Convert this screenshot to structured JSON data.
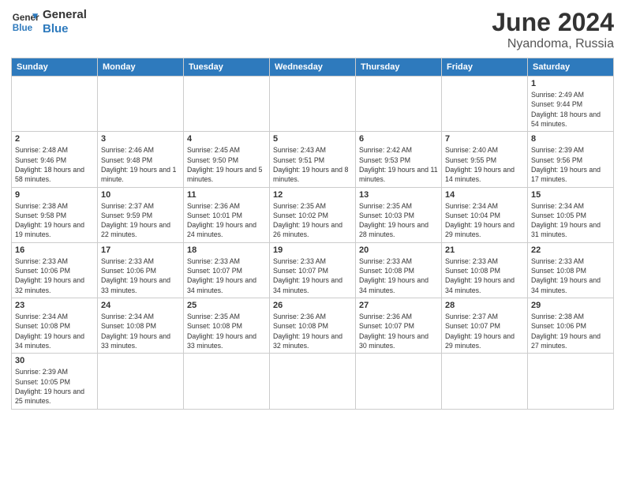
{
  "header": {
    "logo_general": "General",
    "logo_blue": "Blue",
    "title": "June 2024",
    "location": "Nyandoma, Russia"
  },
  "weekdays": [
    "Sunday",
    "Monday",
    "Tuesday",
    "Wednesday",
    "Thursday",
    "Friday",
    "Saturday"
  ],
  "days": {
    "d1": {
      "num": "1",
      "sunrise": "2:49 AM",
      "sunset": "9:44 PM",
      "daylight": "18 hours and 54 minutes."
    },
    "d2": {
      "num": "2",
      "sunrise": "2:48 AM",
      "sunset": "9:46 PM",
      "daylight": "18 hours and 58 minutes."
    },
    "d3": {
      "num": "3",
      "sunrise": "2:46 AM",
      "sunset": "9:48 PM",
      "daylight": "19 hours and 1 minute."
    },
    "d4": {
      "num": "4",
      "sunrise": "2:45 AM",
      "sunset": "9:50 PM",
      "daylight": "19 hours and 5 minutes."
    },
    "d5": {
      "num": "5",
      "sunrise": "2:43 AM",
      "sunset": "9:51 PM",
      "daylight": "19 hours and 8 minutes."
    },
    "d6": {
      "num": "6",
      "sunrise": "2:42 AM",
      "sunset": "9:53 PM",
      "daylight": "19 hours and 11 minutes."
    },
    "d7": {
      "num": "7",
      "sunrise": "2:40 AM",
      "sunset": "9:55 PM",
      "daylight": "19 hours and 14 minutes."
    },
    "d8": {
      "num": "8",
      "sunrise": "2:39 AM",
      "sunset": "9:56 PM",
      "daylight": "19 hours and 17 minutes."
    },
    "d9": {
      "num": "9",
      "sunrise": "2:38 AM",
      "sunset": "9:58 PM",
      "daylight": "19 hours and 19 minutes."
    },
    "d10": {
      "num": "10",
      "sunrise": "2:37 AM",
      "sunset": "9:59 PM",
      "daylight": "19 hours and 22 minutes."
    },
    "d11": {
      "num": "11",
      "sunrise": "2:36 AM",
      "sunset": "10:01 PM",
      "daylight": "19 hours and 24 minutes."
    },
    "d12": {
      "num": "12",
      "sunrise": "2:35 AM",
      "sunset": "10:02 PM",
      "daylight": "19 hours and 26 minutes."
    },
    "d13": {
      "num": "13",
      "sunrise": "2:35 AM",
      "sunset": "10:03 PM",
      "daylight": "19 hours and 28 minutes."
    },
    "d14": {
      "num": "14",
      "sunrise": "2:34 AM",
      "sunset": "10:04 PM",
      "daylight": "19 hours and 29 minutes."
    },
    "d15": {
      "num": "15",
      "sunrise": "2:34 AM",
      "sunset": "10:05 PM",
      "daylight": "19 hours and 31 minutes."
    },
    "d16": {
      "num": "16",
      "sunrise": "2:33 AM",
      "sunset": "10:06 PM",
      "daylight": "19 hours and 32 minutes."
    },
    "d17": {
      "num": "17",
      "sunrise": "2:33 AM",
      "sunset": "10:06 PM",
      "daylight": "19 hours and 33 minutes."
    },
    "d18": {
      "num": "18",
      "sunrise": "2:33 AM",
      "sunset": "10:07 PM",
      "daylight": "19 hours and 34 minutes."
    },
    "d19": {
      "num": "19",
      "sunrise": "2:33 AM",
      "sunset": "10:07 PM",
      "daylight": "19 hours and 34 minutes."
    },
    "d20": {
      "num": "20",
      "sunrise": "2:33 AM",
      "sunset": "10:08 PM",
      "daylight": "19 hours and 34 minutes."
    },
    "d21": {
      "num": "21",
      "sunrise": "2:33 AM",
      "sunset": "10:08 PM",
      "daylight": "19 hours and 34 minutes."
    },
    "d22": {
      "num": "22",
      "sunrise": "2:33 AM",
      "sunset": "10:08 PM",
      "daylight": "19 hours and 34 minutes."
    },
    "d23": {
      "num": "23",
      "sunrise": "2:34 AM",
      "sunset": "10:08 PM",
      "daylight": "19 hours and 34 minutes."
    },
    "d24": {
      "num": "24",
      "sunrise": "2:34 AM",
      "sunset": "10:08 PM",
      "daylight": "19 hours and 33 minutes."
    },
    "d25": {
      "num": "25",
      "sunrise": "2:35 AM",
      "sunset": "10:08 PM",
      "daylight": "19 hours and 33 minutes."
    },
    "d26": {
      "num": "26",
      "sunrise": "2:36 AM",
      "sunset": "10:08 PM",
      "daylight": "19 hours and 32 minutes."
    },
    "d27": {
      "num": "27",
      "sunrise": "2:36 AM",
      "sunset": "10:07 PM",
      "daylight": "19 hours and 30 minutes."
    },
    "d28": {
      "num": "28",
      "sunrise": "2:37 AM",
      "sunset": "10:07 PM",
      "daylight": "19 hours and 29 minutes."
    },
    "d29": {
      "num": "29",
      "sunrise": "2:38 AM",
      "sunset": "10:06 PM",
      "daylight": "19 hours and 27 minutes."
    },
    "d30": {
      "num": "30",
      "sunrise": "2:39 AM",
      "sunset": "10:05 PM",
      "daylight": "19 hours and 25 minutes."
    }
  }
}
